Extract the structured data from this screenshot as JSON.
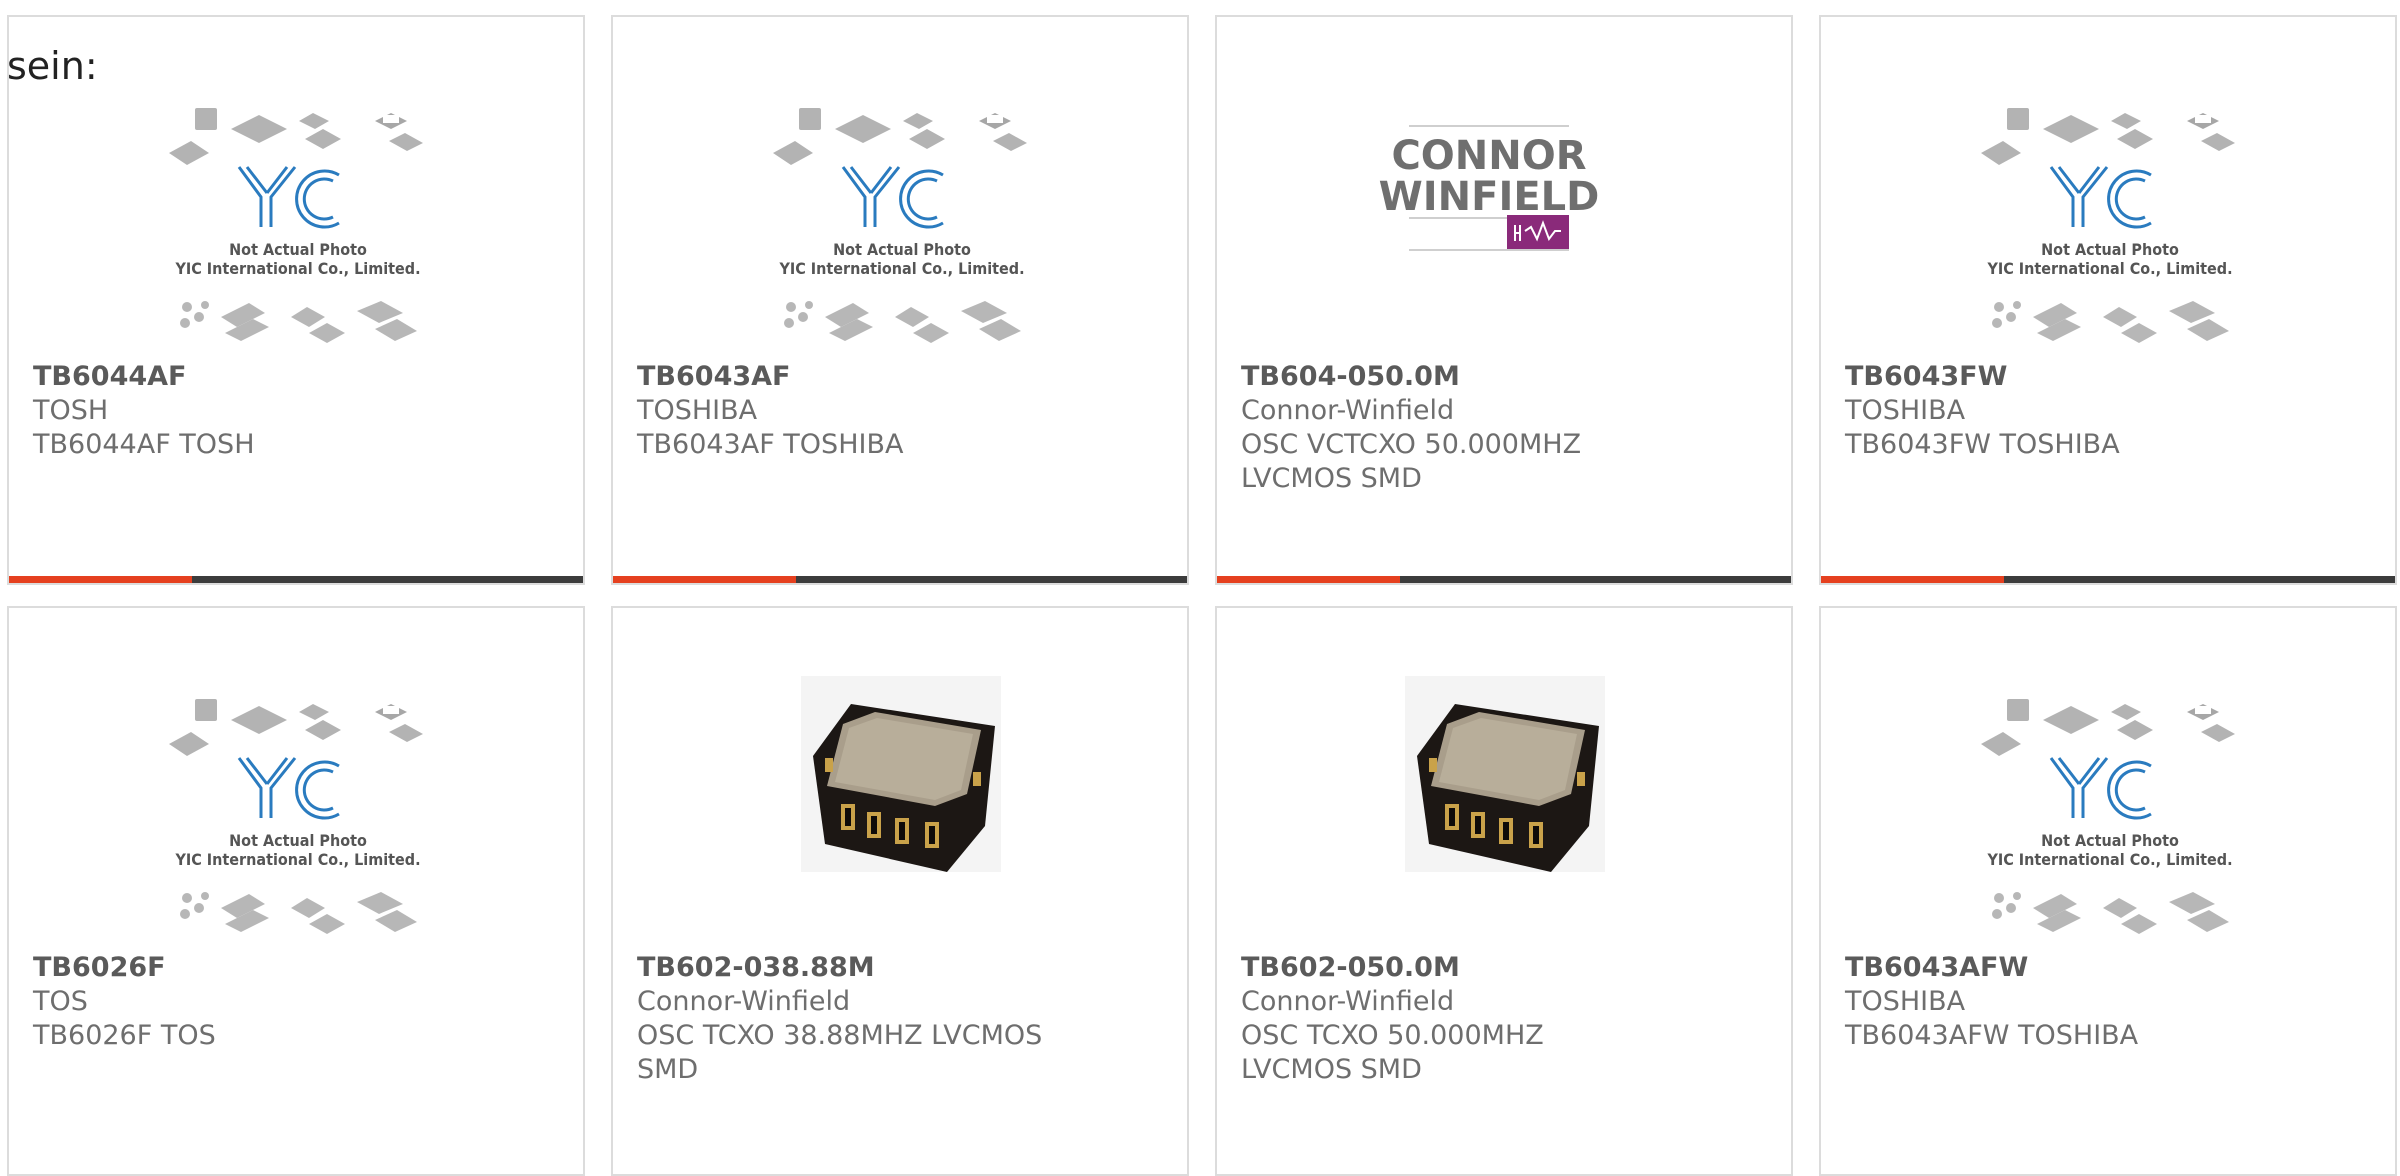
{
  "page": {
    "heading": "sein:",
    "accent_color": "#e5401f",
    "bar_color": "#3c3c3c"
  },
  "products": [
    {
      "part": "TB6044AF",
      "manufacturer": "TOSH",
      "description": "TB6044AF TOSH",
      "image": "yic-placeholder",
      "placeholder_line1": "Not Actual Photo",
      "placeholder_line2": "YIC International Co., Limited.",
      "show_bar": true
    },
    {
      "part": "TB6043AF",
      "manufacturer": "TOSHIBA",
      "description": "TB6043AF TOSHIBA",
      "image": "yic-placeholder",
      "placeholder_line1": "Not Actual Photo",
      "placeholder_line2": "YIC International Co., Limited.",
      "show_bar": true
    },
    {
      "part": "TB604-050.0M",
      "manufacturer": "Connor-Winfield",
      "description": "OSC VCTCXO 50.000MHZ LVCMOS SMD",
      "image": "connor-winfield-logo",
      "logo_line1": "CONNOR",
      "logo_line2": "WINFIELD",
      "show_bar": true
    },
    {
      "part": "TB6043FW",
      "manufacturer": "TOSHIBA",
      "description": "TB6043FW TOSHIBA",
      "image": "yic-placeholder",
      "placeholder_line1": "Not Actual Photo",
      "placeholder_line2": "YIC International Co., Limited.",
      "show_bar": true
    },
    {
      "part": "TB6026F",
      "manufacturer": "TOS",
      "description": "TB6026F TOS",
      "image": "yic-placeholder",
      "placeholder_line1": "Not Actual Photo",
      "placeholder_line2": "YIC International Co., Limited.",
      "show_bar": false
    },
    {
      "part": "TB602-038.88M",
      "manufacturer": "Connor-Winfield",
      "description": "OSC TCXO 38.88MHZ LVCMOS SMD",
      "image": "oscillator-photo",
      "show_bar": false
    },
    {
      "part": "TB602-050.0M",
      "manufacturer": "Connor-Winfield",
      "description": "OSC TCXO 50.000MHZ LVCMOS SMD",
      "image": "oscillator-photo",
      "show_bar": false
    },
    {
      "part": "TB6043AFW",
      "manufacturer": "TOSHIBA",
      "description": "TB6043AFW TOSHIBA",
      "image": "yic-placeholder",
      "placeholder_line1": "Not Actual Photo",
      "placeholder_line2": "YIC International Co., Limited.",
      "show_bar": false
    }
  ]
}
